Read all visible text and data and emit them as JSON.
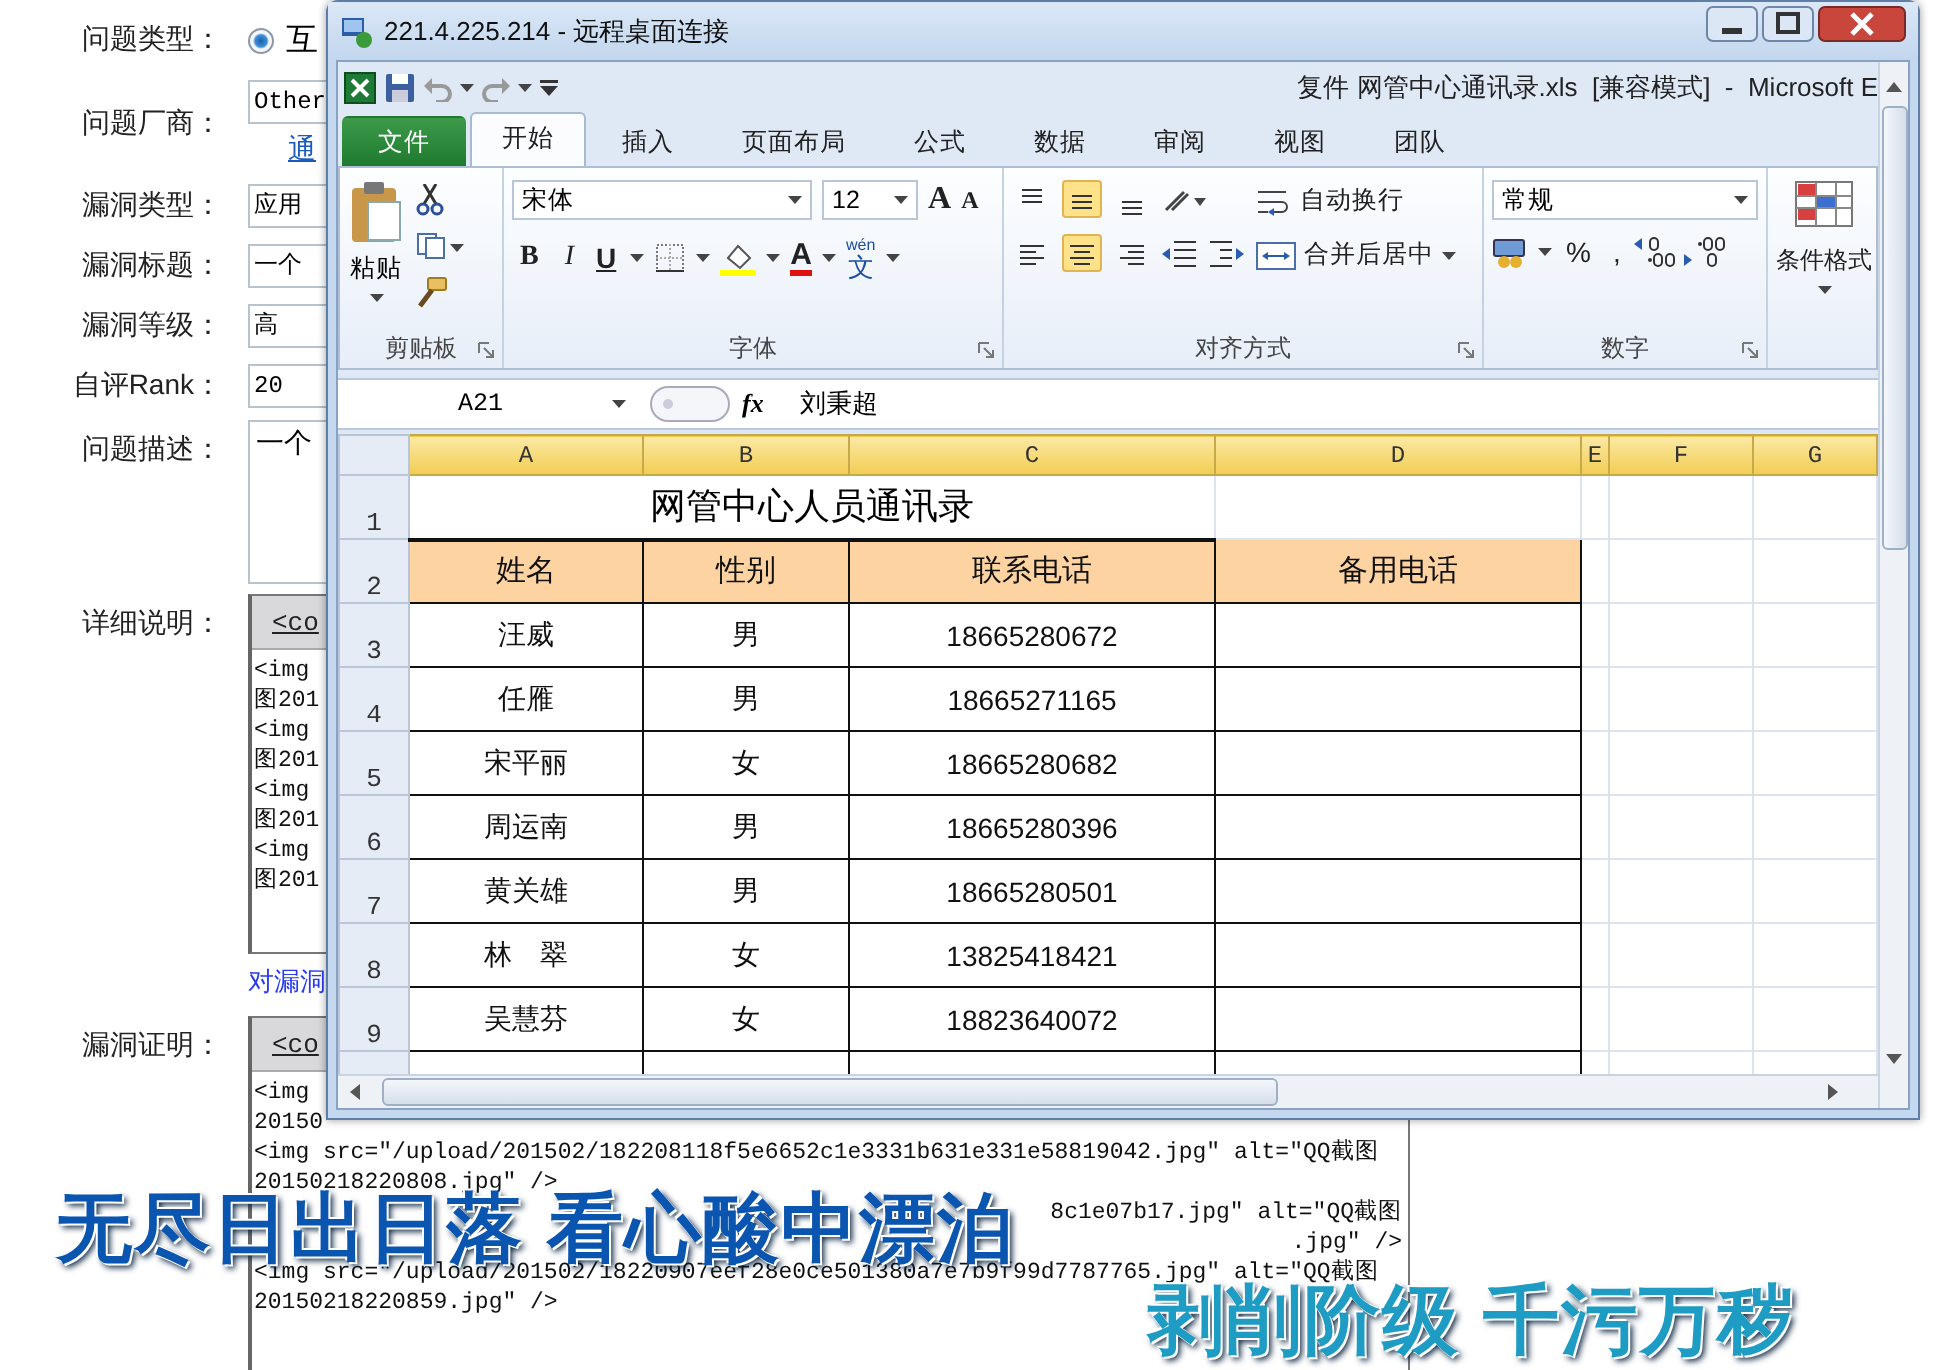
{
  "form": {
    "fields": [
      {
        "kind": "radio",
        "label": "问题类型：",
        "value": "互",
        "checked": true
      },
      {
        "kind": "input",
        "label": "问题厂商：",
        "value": "Other",
        "link": "通"
      },
      {
        "kind": "select",
        "label": "漏洞类型：",
        "value": "应用"
      },
      {
        "kind": "input",
        "label": "漏洞标题：",
        "value": "一个"
      },
      {
        "kind": "input",
        "label": "漏洞等级：",
        "value": "高"
      },
      {
        "kind": "input",
        "label": "自评Rank：",
        "value": "20"
      },
      {
        "kind": "textarea",
        "label": "问题描述：",
        "value": "一个"
      },
      {
        "kind": "editor",
        "label": "详细说明：",
        "toolbar_link": "<co",
        "lines": [
          {
            "kind": "full",
            "text": "<img"
          },
          {
            "kind": "full",
            "text": "图201"
          },
          {
            "kind": "full",
            "text": "<img"
          },
          {
            "kind": "full",
            "text": "图201"
          },
          {
            "kind": "full",
            "text": "<img"
          },
          {
            "kind": "full",
            "text": "图201"
          },
          {
            "kind": "full",
            "text": "<img"
          },
          {
            "kind": "full",
            "text": "图201"
          }
        ],
        "note": "对漏洞"
      },
      {
        "kind": "editor",
        "label": "漏洞证明：",
        "toolbar_link": "<co",
        "lines": [
          {
            "kind": "full",
            "text": "<img"
          },
          {
            "kind": "full",
            "text": "20150"
          },
          {
            "kind": "full",
            "text": "<img src=\"/upload/201502/182208118f5e6652c1e3331b631e331e58819042.jpg\" alt=\"QQ截图"
          },
          {
            "kind": "full",
            "text": "20150218220808.jpg\" />"
          },
          {
            "kind": "tail",
            "text": "8c1e07b17.jpg\" alt=\"QQ截图"
          },
          {
            "kind": "tail",
            "text": ".jpg\" />"
          },
          {
            "kind": "full",
            "text": "<img src=\"/upload/201502/18220907eef28e0ce501380a7e7b9f99d7787765.jpg\" alt=\"QQ截图"
          },
          {
            "kind": "full",
            "text": "20150218220859.jpg\" />"
          }
        ]
      }
    ]
  },
  "remote_window": {
    "title": "221.4.225.214 - 远程桌面连接"
  },
  "excel": {
    "title": "复件 网管中心通讯录.xls  [兼容模式]  -  Microsoft E",
    "tabs": [
      {
        "kind": "file",
        "label": "文件",
        "selected": false
      },
      {
        "kind": "tab",
        "label": "开始",
        "selected": true
      },
      {
        "kind": "tab",
        "label": "插入",
        "selected": false
      },
      {
        "kind": "tab",
        "label": "页面布局",
        "selected": false
      },
      {
        "kind": "tab",
        "label": "公式",
        "selected": false
      },
      {
        "kind": "tab",
        "label": "数据",
        "selected": false
      },
      {
        "kind": "tab",
        "label": "审阅",
        "selected": false
      },
      {
        "kind": "tab",
        "label": "视图",
        "selected": false
      },
      {
        "kind": "tab",
        "label": "团队",
        "selected": false
      }
    ],
    "ribbon": [
      {
        "kind": "clipboard",
        "label": "剪贴板",
        "paste": "粘贴"
      },
      {
        "kind": "font",
        "label": "字体",
        "font": "宋体",
        "size": "12",
        "size_buttons": [
          "A",
          "A"
        ],
        "style_buttons": [
          "B",
          "I",
          "U"
        ],
        "color_button": "A",
        "phonetic_ruby": "wén",
        "phonetic": "文"
      },
      {
        "kind": "alignment",
        "label": "对齐方式",
        "valign": [
          {
            "selected": false
          },
          {
            "selected": true
          },
          {
            "selected": false
          }
        ],
        "halign": [
          {
            "selected": false
          },
          {
            "selected": true
          },
          {
            "selected": false
          }
        ],
        "wrap": "自动换行",
        "merge": "合并后居中"
      },
      {
        "kind": "number",
        "label": "数字",
        "format": "常规",
        "buttons": [
          "%",
          ","
        ]
      },
      {
        "kind": "styles",
        "label": "条件格式"
      }
    ],
    "name_box": "A21",
    "function_label": "fx",
    "formula": "刘秉超",
    "sheet": {
      "columns": [
        "A",
        "B",
        "C",
        "D",
        "E",
        "F",
        "G"
      ],
      "title_row": {
        "number": "1",
        "title": "网管中心人员通讯录"
      },
      "header_row": {
        "number": "2",
        "cells": [
          "姓名",
          "性别",
          "联系电话",
          "备用电话"
        ]
      },
      "rows": [
        {
          "number": "3",
          "cells": [
            "汪威",
            "男",
            "18665280672"
          ]
        },
        {
          "number": "4",
          "cells": [
            "任雁",
            "男",
            "18665271165"
          ]
        },
        {
          "number": "5",
          "cells": [
            "宋平丽",
            "女",
            "18665280682"
          ]
        },
        {
          "number": "6",
          "cells": [
            "周运南",
            "男",
            "18665280396"
          ]
        },
        {
          "number": "7",
          "cells": [
            "黄关雄",
            "男",
            "18665280501"
          ]
        },
        {
          "number": "8",
          "cells": [
            "林　翠",
            "女",
            "13825418421"
          ]
        },
        {
          "number": "9",
          "cells": [
            "吴慧芬",
            "女",
            "18823640072"
          ]
        }
      ]
    }
  },
  "captions": [
    {
      "kind": "dark",
      "text": "无尽日出日落 看心酸中漂泊"
    },
    {
      "kind": "light",
      "text": "剥削阶级 千污万秽"
    }
  ]
}
